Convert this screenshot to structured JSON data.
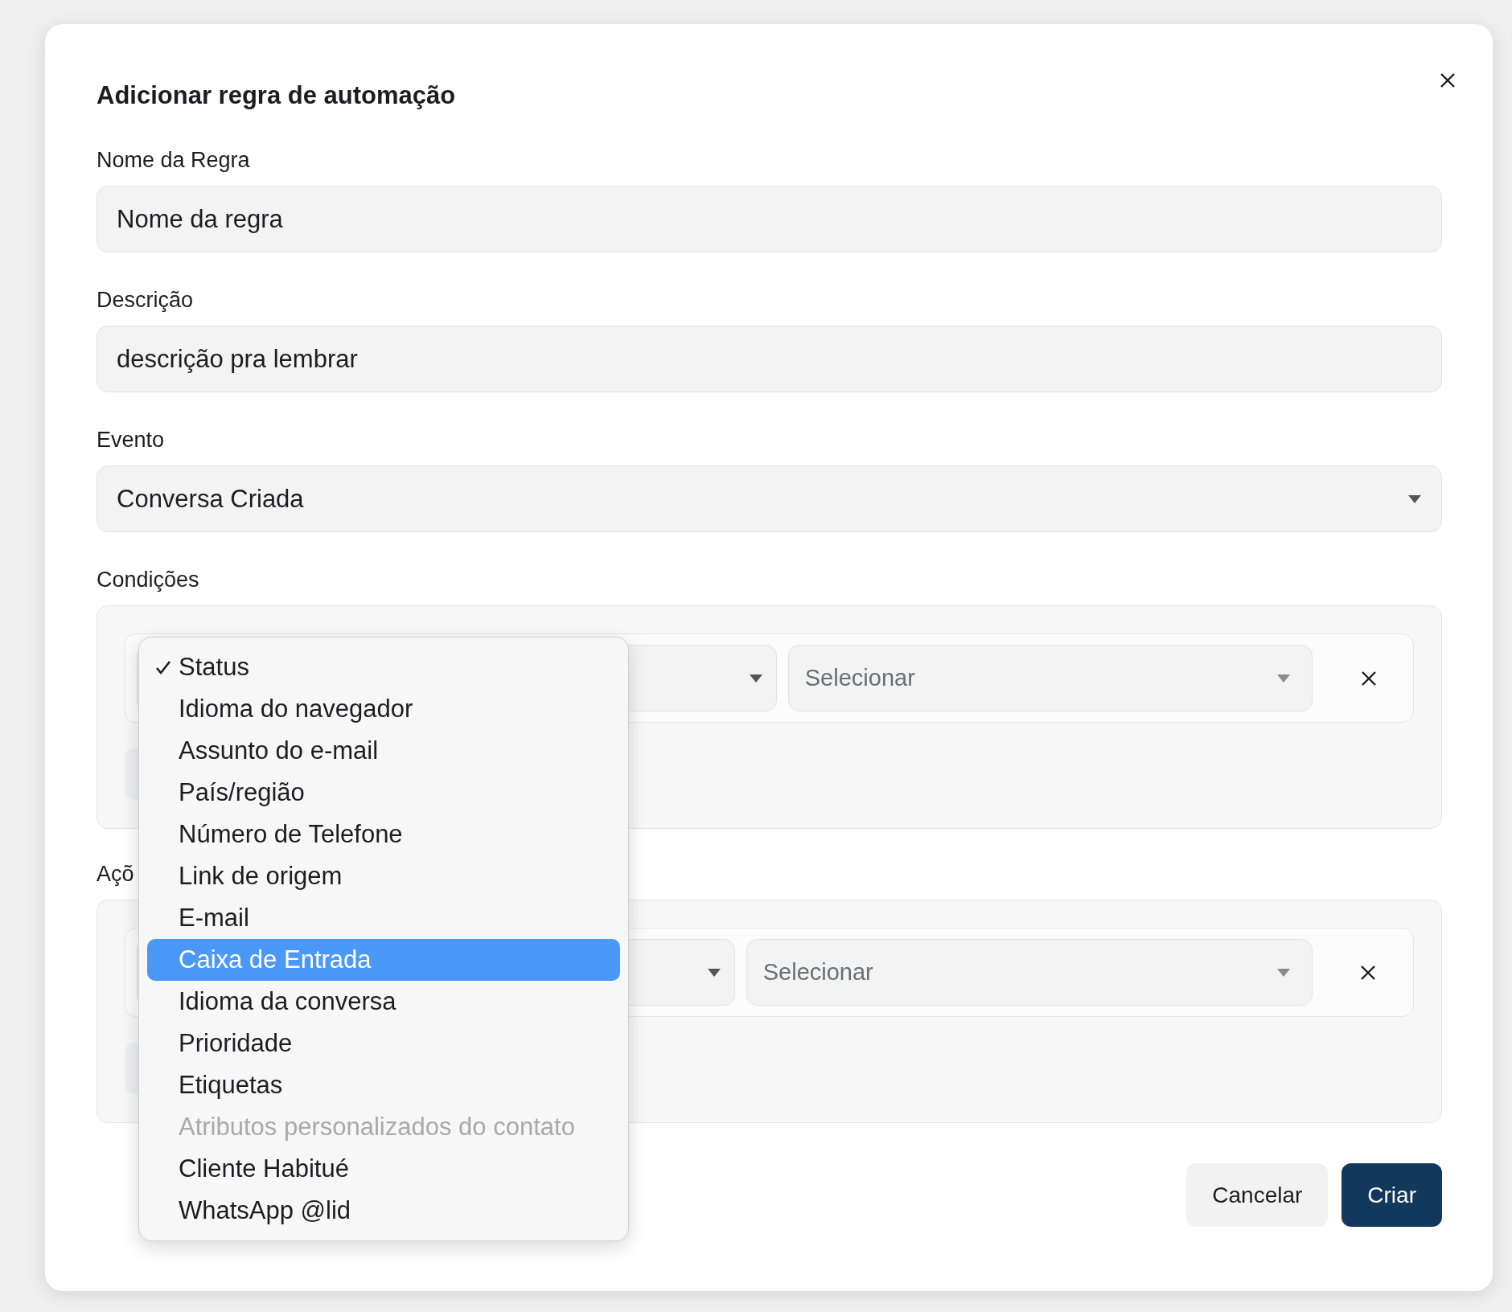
{
  "dialog": {
    "title": "Adicionar regra de automação"
  },
  "fields": [
    {
      "kind": "text",
      "label": "Nome da Regra",
      "value": "Nome da regra"
    },
    {
      "kind": "text",
      "label": "Descrição",
      "value": "descrição pra lembrar"
    },
    {
      "kind": "select",
      "label": "Evento",
      "value": "Conversa Criada"
    }
  ],
  "conditions": {
    "label": "Condições",
    "rows": [
      {
        "value_placeholder": "Selecionar"
      }
    ]
  },
  "actions": {
    "label": "Açõ",
    "rows": [
      {
        "value_placeholder": "Selecionar"
      }
    ]
  },
  "dropdown": {
    "options": [
      {
        "label": "Status",
        "checked": true,
        "highlighted": false,
        "disabled": false
      },
      {
        "label": "Idioma do navegador",
        "checked": false,
        "highlighted": false,
        "disabled": false
      },
      {
        "label": "Assunto do e-mail",
        "checked": false,
        "highlighted": false,
        "disabled": false
      },
      {
        "label": "País/região",
        "checked": false,
        "highlighted": false,
        "disabled": false
      },
      {
        "label": "Número de Telefone",
        "checked": false,
        "highlighted": false,
        "disabled": false
      },
      {
        "label": "Link de origem",
        "checked": false,
        "highlighted": false,
        "disabled": false
      },
      {
        "label": "E-mail",
        "checked": false,
        "highlighted": false,
        "disabled": false
      },
      {
        "label": "Caixa de Entrada",
        "checked": false,
        "highlighted": true,
        "disabled": false
      },
      {
        "label": "Idioma da conversa",
        "checked": false,
        "highlighted": false,
        "disabled": false
      },
      {
        "label": "Prioridade",
        "checked": false,
        "highlighted": false,
        "disabled": false
      },
      {
        "label": "Etiquetas",
        "checked": false,
        "highlighted": false,
        "disabled": false
      },
      {
        "label": "Atributos personalizados do contato",
        "checked": false,
        "highlighted": false,
        "disabled": true
      },
      {
        "label": "Cliente Habitué",
        "checked": false,
        "highlighted": false,
        "disabled": false
      },
      {
        "label": "WhatsApp @lid",
        "checked": false,
        "highlighted": false,
        "disabled": false
      }
    ]
  },
  "buttons": [
    {
      "kind": "secondary",
      "label": "Cancelar"
    },
    {
      "kind": "primary",
      "label": "Criar"
    }
  ]
}
